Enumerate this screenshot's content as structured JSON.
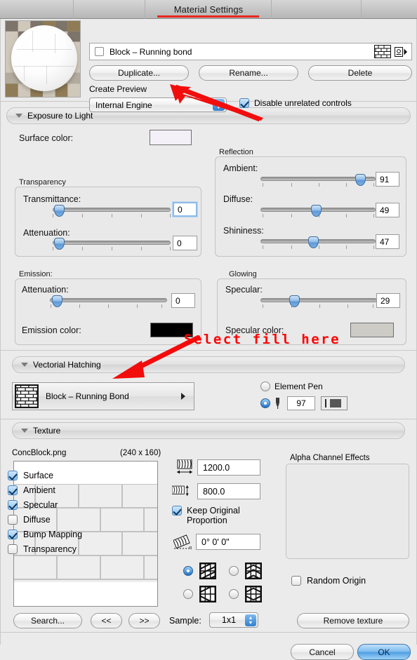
{
  "window": {
    "title": "Material Settings"
  },
  "header": {
    "material_checkbox_checked": false,
    "material_name": "Block – Running bond",
    "brick_icon": "brick-pattern-icon",
    "export_icon": "export-material-icon",
    "buttons": {
      "duplicate": "Duplicate...",
      "rename": "Rename...",
      "delete": "Delete"
    },
    "create_preview_label": "Create Preview",
    "engine_value": "Internal Engine",
    "disable_unrelated_label": "Disable unrelated controls",
    "disable_unrelated_checked": true
  },
  "exposure": {
    "section_title": "Exposure to Light",
    "surface_color_label": "Surface color:",
    "surface_color": "#f4f0f8",
    "transparency": {
      "group_label": "Transparency",
      "transmittance_label": "Transmittance:",
      "transmittance_value": "0",
      "attenuation_label": "Attenuation:",
      "attenuation_value": "0"
    },
    "reflection": {
      "group_label": "Reflection",
      "ambient_label": "Ambient:",
      "ambient_value": "91",
      "diffuse_label": "Diffuse:",
      "diffuse_value": "49",
      "shininess_label": "Shininess:",
      "shininess_value": "47"
    },
    "emission": {
      "group_label": "Emission:",
      "attenuation_label": "Attenuation:",
      "attenuation_value": "0",
      "color_label": "Emission color:",
      "color": "#000000"
    },
    "glowing": {
      "group_label": "Glowing",
      "specular_label": "Specular:",
      "specular_value": "29",
      "color_label": "Specular color:",
      "color": "#cdcbc6"
    }
  },
  "hatching": {
    "section_title": "Vectorial Hatching",
    "fill_name": "Block – Running Bond",
    "fill_icon": "running-bond-pattern-icon",
    "element_pen_label": "Element Pen",
    "element_pen_selected": false,
    "custom_pen_selected": true,
    "pen_number": "97",
    "pen_icon": "pen-nib-icon"
  },
  "texture": {
    "section_title": "Texture",
    "filename": "ConcBlock.png",
    "dimensions": "(240 x 160)",
    "width_value": "1200.0",
    "height_value": "800.0",
    "keep_proportion_label": "Keep Original Proportion",
    "keep_proportion_checked": true,
    "angle_value": "0° 0' 0\"",
    "width_icon": "texture-width-icon",
    "height_icon": "texture-height-icon",
    "angle_icon": "texture-angle-icon",
    "mirror_options": [
      {
        "name": "mirror-none",
        "selected": true
      },
      {
        "name": "mirror-vertical",
        "selected": false
      },
      {
        "name": "mirror-horizontal",
        "selected": false
      },
      {
        "name": "mirror-both",
        "selected": false
      }
    ],
    "alpha": {
      "group_label": "Alpha Channel Effects",
      "items": [
        {
          "label": "Surface",
          "checked": true
        },
        {
          "label": "Ambient",
          "checked": true
        },
        {
          "label": "Specular",
          "checked": true
        },
        {
          "label": "Diffuse",
          "checked": false
        },
        {
          "label": "Bump Mapping",
          "checked": true
        },
        {
          "label": "Transparency",
          "checked": false
        }
      ]
    },
    "random_origin_label": "Random Origin",
    "random_origin_checked": false,
    "search_label": "Search...",
    "prev_label": "<<",
    "next_label": ">>",
    "sample_label": "Sample:",
    "sample_value": "1x1",
    "remove_texture_label": "Remove texture"
  },
  "footer": {
    "cancel": "Cancel",
    "ok": "OK"
  },
  "annotations": {
    "callout_text": "Select fill here",
    "color": "#ff0000"
  }
}
